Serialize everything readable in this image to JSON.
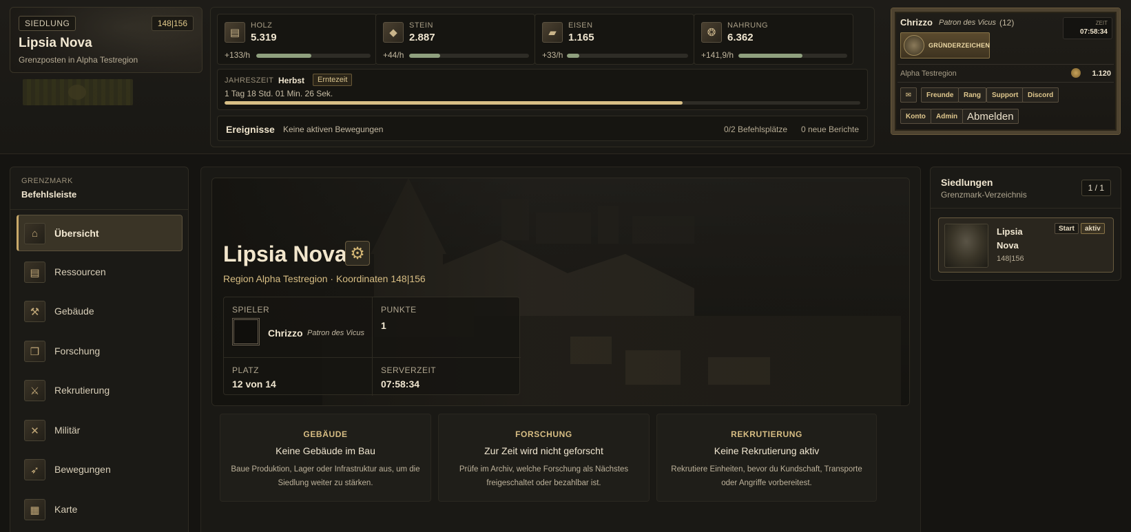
{
  "settlement": {
    "tag": "SIEDLUNG",
    "coords": "148|156",
    "name": "Lipsia Nova",
    "subtitle": "Grenzposten in Alpha Testregion"
  },
  "resources": [
    {
      "label": "HOLZ",
      "value": "5.319",
      "rate": "+133/h",
      "fill": 0.48,
      "icon": "wood-icon"
    },
    {
      "label": "STEIN",
      "value": "2.887",
      "rate": "+44/h",
      "fill": 0.26,
      "icon": "stone-icon"
    },
    {
      "label": "EISEN",
      "value": "1.165",
      "rate": "+33/h",
      "fill": 0.1,
      "icon": "iron-icon"
    },
    {
      "label": "NAHRUNG",
      "value": "6.362",
      "rate": "+141,9/h",
      "fill": 0.59,
      "icon": "food-icon"
    }
  ],
  "season": {
    "label": "JAHRESZEIT",
    "name": "Herbst",
    "badge": "Erntezeit",
    "remaining": "1 Tag 18 Std. 01 Min. 26 Sek.",
    "progress": 0.72
  },
  "events": {
    "title": "Ereignisse",
    "text": "Keine aktiven Bewegungen",
    "slots": "0/2 Befehlsplätze",
    "reports": "0 neue Berichte"
  },
  "player": {
    "name": "Chrizzo",
    "title": "Patron des Vicus",
    "level": "(12)",
    "clock_label": "ZEIT",
    "clock_time": "07:58:34",
    "founder_label": "GRÜNDERZEICHEN",
    "region": "Alpha Testregion",
    "coins": "1.120",
    "buttons": {
      "mail": "✉",
      "friends": "Freunde",
      "rank": "Rang",
      "support": "Support",
      "discord": "Discord",
      "account": "Konto",
      "admin": "Admin",
      "logout": "Abmelden"
    }
  },
  "sidebar": {
    "kicker": "GRENZMARK",
    "title": "Befehlsleiste",
    "items": [
      {
        "label": "Übersicht",
        "icon": "overview-icon",
        "glyph": "⌂",
        "active": true
      },
      {
        "label": "Ressourcen",
        "icon": "resources-icon",
        "glyph": "▤",
        "active": false
      },
      {
        "label": "Gebäude",
        "icon": "hammer-icon",
        "glyph": "⚒",
        "active": false
      },
      {
        "label": "Forschung",
        "icon": "book-icon",
        "glyph": "❒",
        "active": false
      },
      {
        "label": "Rekrutierung",
        "icon": "recruit-icon",
        "glyph": "⚔",
        "active": false
      },
      {
        "label": "Militär",
        "icon": "crossed-swords-icon",
        "glyph": "✕",
        "active": false
      },
      {
        "label": "Bewegungen",
        "icon": "movement-icon",
        "glyph": "➶",
        "active": false
      },
      {
        "label": "Karte",
        "icon": "map-icon",
        "glyph": "▦",
        "active": false
      }
    ]
  },
  "hero": {
    "name": "Lipsia Nova",
    "gear_icon": "gear-icon",
    "subtitle": "Region Alpha Testregion · Koordinaten 148|156",
    "stats": {
      "player_label": "SPIELER",
      "player_name": "Chrizzo",
      "player_title": "Patron des Vicus",
      "points_label": "PUNKTE",
      "points_value": "1",
      "rank_label": "PLATZ",
      "rank_value": "12 von 14",
      "servertime_label": "SERVERZEIT",
      "servertime_value": "07:58:34"
    }
  },
  "info_cards": [
    {
      "title": "GEBÄUDE",
      "head": "Keine Gebäude im Bau",
      "desc": "Baue Produktion, Lager oder Infrastruktur aus, um die Siedlung weiter zu stärken."
    },
    {
      "title": "FORSCHUNG",
      "head": "Zur Zeit wird nicht geforscht",
      "desc": "Prüfe im Archiv, welche Forschung als Nächstes freigeschaltet oder bezahlbar ist."
    },
    {
      "title": "REKRUTIERUNG",
      "head": "Keine Rekrutierung aktiv",
      "desc": "Rekrutiere Einheiten, bevor du Kundschaft, Transporte oder Angriffe vorbereitest."
    }
  ],
  "settlements_panel": {
    "title": "Siedlungen",
    "subtitle": "Grenzmark-Verzeichnis",
    "pages": "1 / 1",
    "items": [
      {
        "name": "Lipsia Nova",
        "coords": "148|156",
        "badge_start": "Start",
        "badge_active": "aktiv"
      }
    ]
  }
}
